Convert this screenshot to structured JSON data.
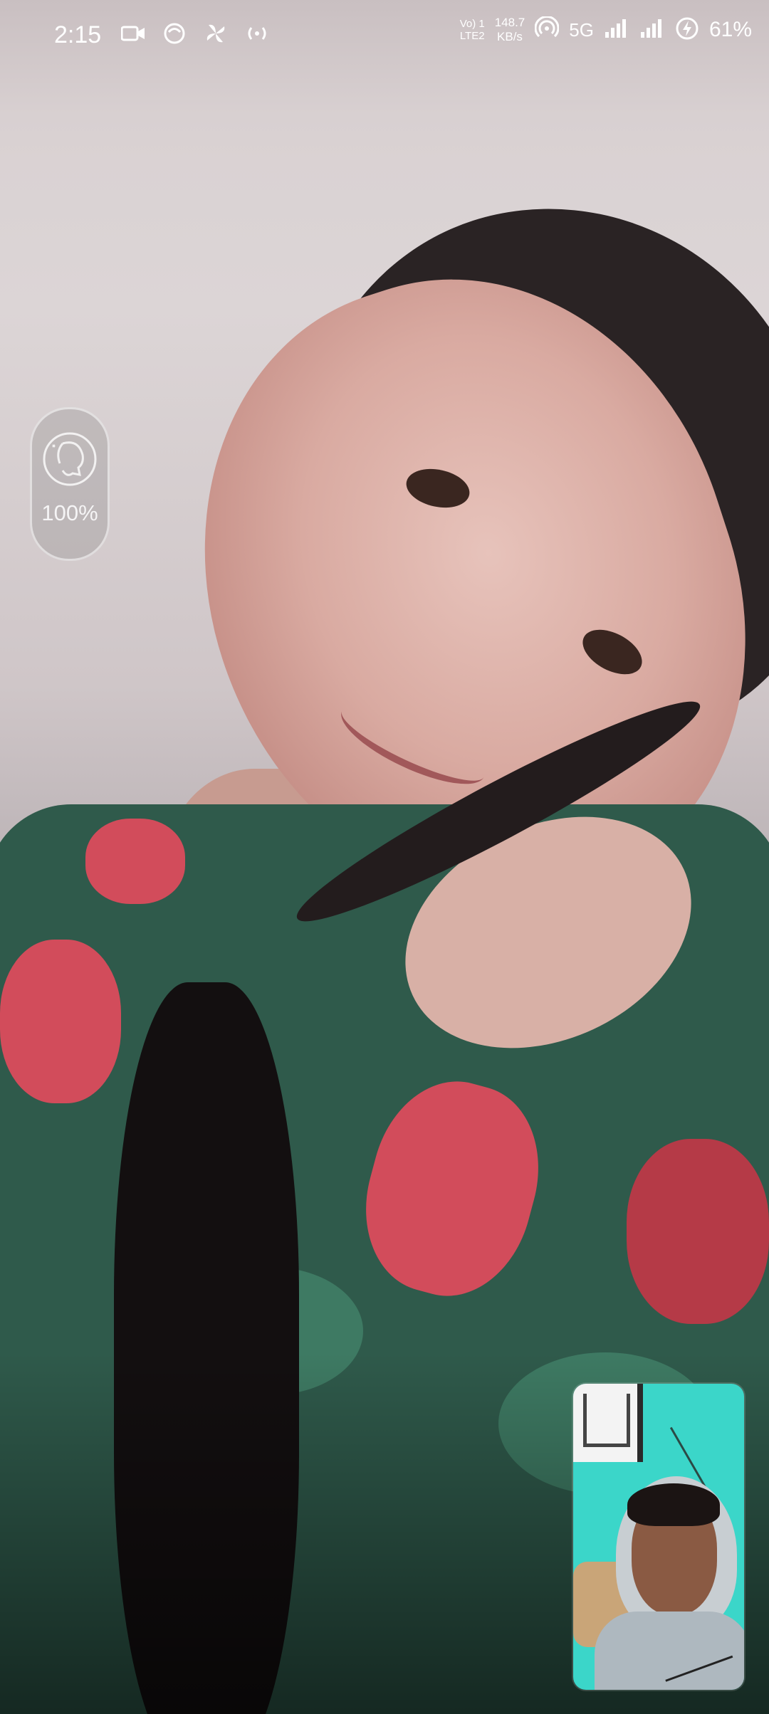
{
  "status_bar": {
    "time": "2:15",
    "left_icons": [
      "video-camera-icon",
      "face-app-icon",
      "pinwheel-app-icon",
      "hotspot-broadcast-icon"
    ],
    "volte_top": "Vo) 1",
    "volte_bottom": "LTE2",
    "net_speed_value": "148.7",
    "net_speed_unit": "KB/s",
    "network_type": "5G",
    "battery_percent": "61%"
  },
  "beauty_filter": {
    "icon": "beauty-face-icon",
    "value": "100%"
  },
  "colors": {
    "status_text": "#ffffff",
    "pip_background": "#3bd6c9"
  }
}
